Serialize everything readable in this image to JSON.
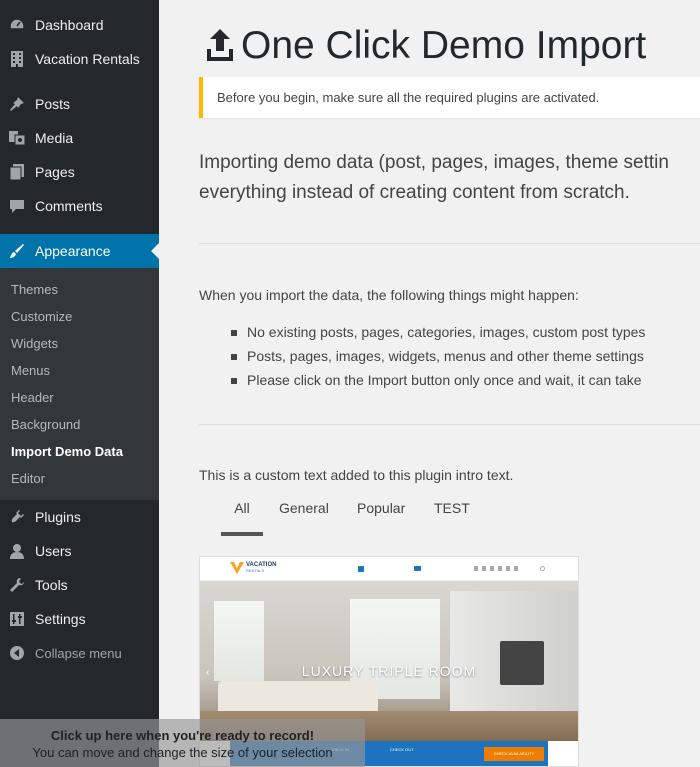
{
  "sidebar": {
    "items": [
      {
        "label": "Dashboard",
        "icon": "dashboard-icon"
      },
      {
        "label": "Vacation Rentals",
        "icon": "building-icon"
      },
      {
        "label": "Posts",
        "icon": "pushpin-icon"
      },
      {
        "label": "Media",
        "icon": "media-icon"
      },
      {
        "label": "Pages",
        "icon": "pages-icon"
      },
      {
        "label": "Comments",
        "icon": "comment-icon"
      },
      {
        "label": "Appearance",
        "icon": "brush-icon"
      },
      {
        "label": "Plugins",
        "icon": "plug-icon"
      },
      {
        "label": "Users",
        "icon": "user-icon"
      },
      {
        "label": "Tools",
        "icon": "wrench-icon"
      },
      {
        "label": "Settings",
        "icon": "sliders-icon"
      },
      {
        "label": "Collapse menu",
        "icon": "collapse-icon"
      }
    ],
    "submenu": [
      "Themes",
      "Customize",
      "Widgets",
      "Menus",
      "Header",
      "Background",
      "Import Demo Data",
      "Editor"
    ],
    "active_color": "#0073aa"
  },
  "main": {
    "title": "One Click Demo Import",
    "notice": "Before you begin, make sure all the required plugins are activated.",
    "intro_line1": "Importing demo data (post, pages, images, theme settin",
    "intro_line2": "everything instead of creating content from scratch.",
    "when_text": "When you import the data, the following things might happen:",
    "bullets": [
      "No existing posts, pages, categories, images, custom post types",
      "Posts, pages, images, widgets, menus and other theme settings",
      "Please click on the Import button only once and wait, it can take"
    ],
    "custom_text": "This is a custom text added to this plugin intro text.",
    "tabs": [
      "All",
      "General",
      "Popular",
      "TEST"
    ],
    "active_tab": "All",
    "demo": {
      "logo_line1": "VACATION",
      "logo_line2": "RENTALS",
      "hero_text": "LUXURY TRIPLE ROOM",
      "book_button": "CHECK AVAILABILITY",
      "check_in": "CHECK IN",
      "check_out": "CHECK OUT"
    }
  },
  "overlay": {
    "line1": "Click up here when you're ready to record!",
    "line2": "You can move and change the size of your selection"
  },
  "colors": {
    "sidebar_bg": "#23282d",
    "submenu_bg": "#32373c",
    "notice_border": "#ffb900"
  }
}
